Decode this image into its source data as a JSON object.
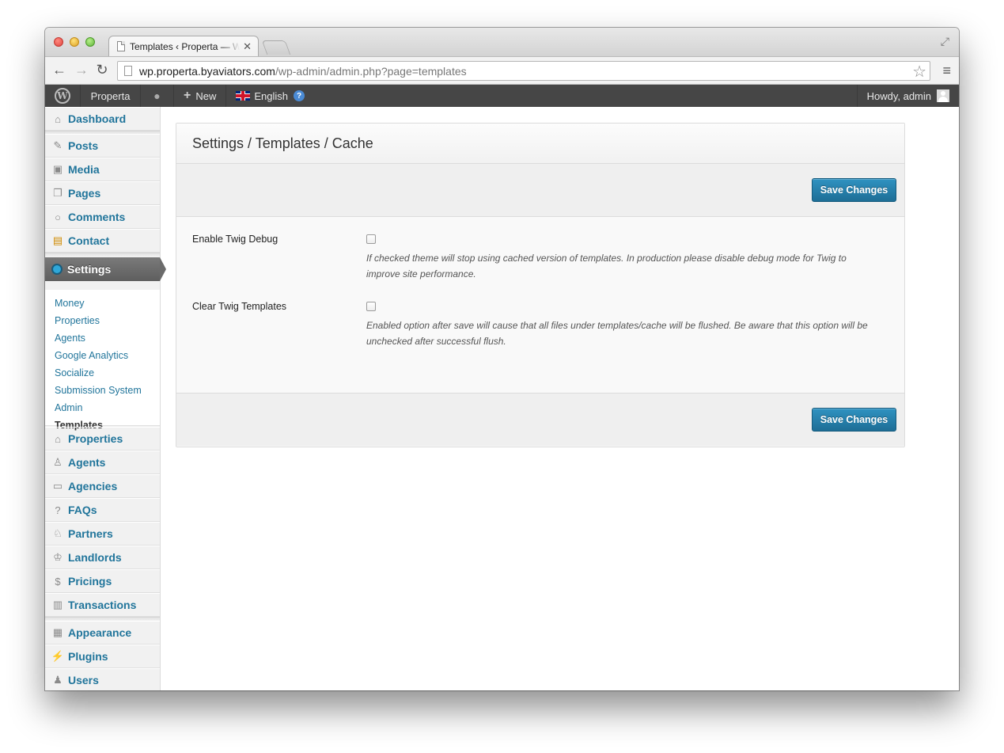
{
  "browser": {
    "tab_title": "Templates ‹ Properta — WordPress",
    "tab_close": "✕",
    "url_host": "wp.properta.byaviators.com",
    "url_path": "/wp-admin/admin.php?page=templates"
  },
  "adminbar": {
    "site_name": "Properta",
    "new_label": "New",
    "language": "English",
    "howdy": "Howdy, admin"
  },
  "sidebar": {
    "top_items": [
      {
        "label": "Dashboard",
        "icon": "dashboard-icon"
      },
      {
        "label": "Posts",
        "icon": "pin-icon"
      },
      {
        "label": "Media",
        "icon": "media-icon"
      },
      {
        "label": "Pages",
        "icon": "pages-icon"
      },
      {
        "label": "Comments",
        "icon": "comment-icon"
      },
      {
        "label": "Contact",
        "icon": "contact-icon"
      }
    ],
    "current": {
      "label": "Settings",
      "icon": "settings-icon"
    },
    "submenu": [
      "Money",
      "Properties",
      "Agents",
      "Google Analytics",
      "Socialize",
      "Submission System",
      "Admin",
      "Templates"
    ],
    "submenu_active": "Templates",
    "post_items": [
      {
        "label": "Properties",
        "icon": "home-icon"
      },
      {
        "label": "Agents",
        "icon": "user-icon"
      },
      {
        "label": "Agencies",
        "icon": "briefcase-icon"
      },
      {
        "label": "FAQs",
        "icon": "question-icon"
      },
      {
        "label": "Partners",
        "icon": "handshake-icon"
      },
      {
        "label": "Landlords",
        "icon": "crown-icon"
      },
      {
        "label": "Pricings",
        "icon": "dollar-icon"
      },
      {
        "label": "Transactions",
        "icon": "money-icon"
      }
    ],
    "bottom_items": [
      {
        "label": "Appearance",
        "icon": "appearance-icon"
      },
      {
        "label": "Plugins",
        "icon": "plug-icon"
      },
      {
        "label": "Users",
        "icon": "users-icon"
      }
    ]
  },
  "main": {
    "title": "Settings / Templates / Cache",
    "save_label": "Save Changes",
    "fields": [
      {
        "label": "Enable Twig Debug",
        "checked": false,
        "desc_line1": "If checked theme will stop using cached version of templates. In production please disable debug mode for Twig to",
        "desc_line2": "improve site performance."
      },
      {
        "label": "Clear Twig Templates",
        "checked": false,
        "desc_line1": "Enabled option after save will cause that all files under templates/cache will be flushed. Be aware that this option will be",
        "desc_line2": "unchecked after successful flush."
      }
    ]
  },
  "colors": {
    "link": "#21759b",
    "button": "#2a87b5",
    "adminbar": "#464646"
  }
}
